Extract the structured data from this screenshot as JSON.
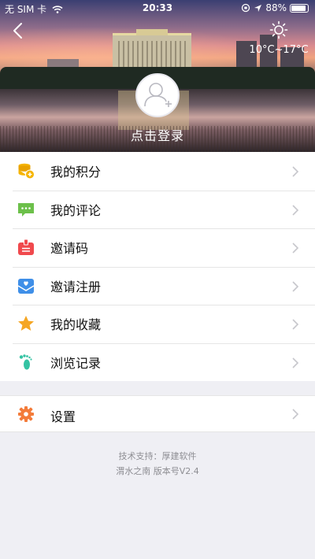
{
  "status": {
    "carrier": "无 SIM 卡",
    "time": "20:33",
    "battery": "88%",
    "battery_level": 0.88
  },
  "weather": {
    "temperature": "10°C~17°C",
    "icon": "sun-icon"
  },
  "profile": {
    "login_label": "点击登录",
    "avatar_icon": "default-avatar-icon"
  },
  "menu": {
    "items": [
      {
        "label": "我的积分",
        "icon": "coins-icon",
        "color": "#f5b400"
      },
      {
        "label": "我的评论",
        "icon": "comment-icon",
        "color": "#6cc04a"
      },
      {
        "label": "邀请码",
        "icon": "badge-icon",
        "color": "#f0494d"
      },
      {
        "label": "邀请注册",
        "icon": "mail-heart-icon",
        "color": "#3f8fe8"
      },
      {
        "label": "我的收藏",
        "icon": "star-icon",
        "color": "#f5a623"
      },
      {
        "label": "浏览记录",
        "icon": "footprint-icon",
        "color": "#34c3a3"
      }
    ]
  },
  "settings": {
    "label": "设置",
    "icon": "gear-icon",
    "color": "#f37b3a"
  },
  "footer": {
    "support": "技术支持：厚建软件",
    "version": "渭水之南  版本号V2.4"
  }
}
